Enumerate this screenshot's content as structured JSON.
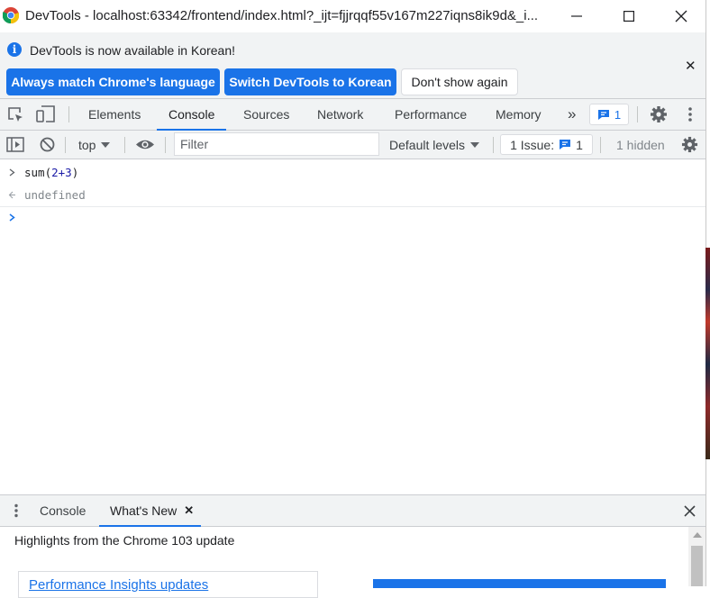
{
  "window": {
    "title": "DevTools - localhost:63342/frontend/index.html?_ijt=fjjrqqf55v167m227iqns8ik9d&_i..."
  },
  "infobar": {
    "message": "DevTools is now available in Korean!",
    "buttons": {
      "match_language": "Always match Chrome's language",
      "switch_korean": "Switch DevTools to Korean",
      "dont_show": "Don't show again"
    }
  },
  "tabs": {
    "elements": "Elements",
    "console": "Console",
    "sources": "Sources",
    "network": "Network",
    "performance": "Performance",
    "memory": "Memory",
    "issues_count": "1"
  },
  "console_toolbar": {
    "context": "top",
    "filter_placeholder": "Filter",
    "levels": "Default levels",
    "issue_label": "1 Issue:",
    "issue_count": "1",
    "hidden": "1 hidden"
  },
  "console": {
    "input_prefix": "sum(",
    "input_arg": "2+3",
    "input_suffix": ")",
    "output": "undefined"
  },
  "drawer": {
    "tabs": {
      "console": "Console",
      "whats_new": "What's New"
    },
    "highlights": "Highlights from the Chrome 103 update",
    "card_link": "Performance Insights updates"
  },
  "colors": {
    "accent": "#1a73e8",
    "toolbar_bg": "#f1f3f4",
    "border": "#cbcdd1"
  }
}
